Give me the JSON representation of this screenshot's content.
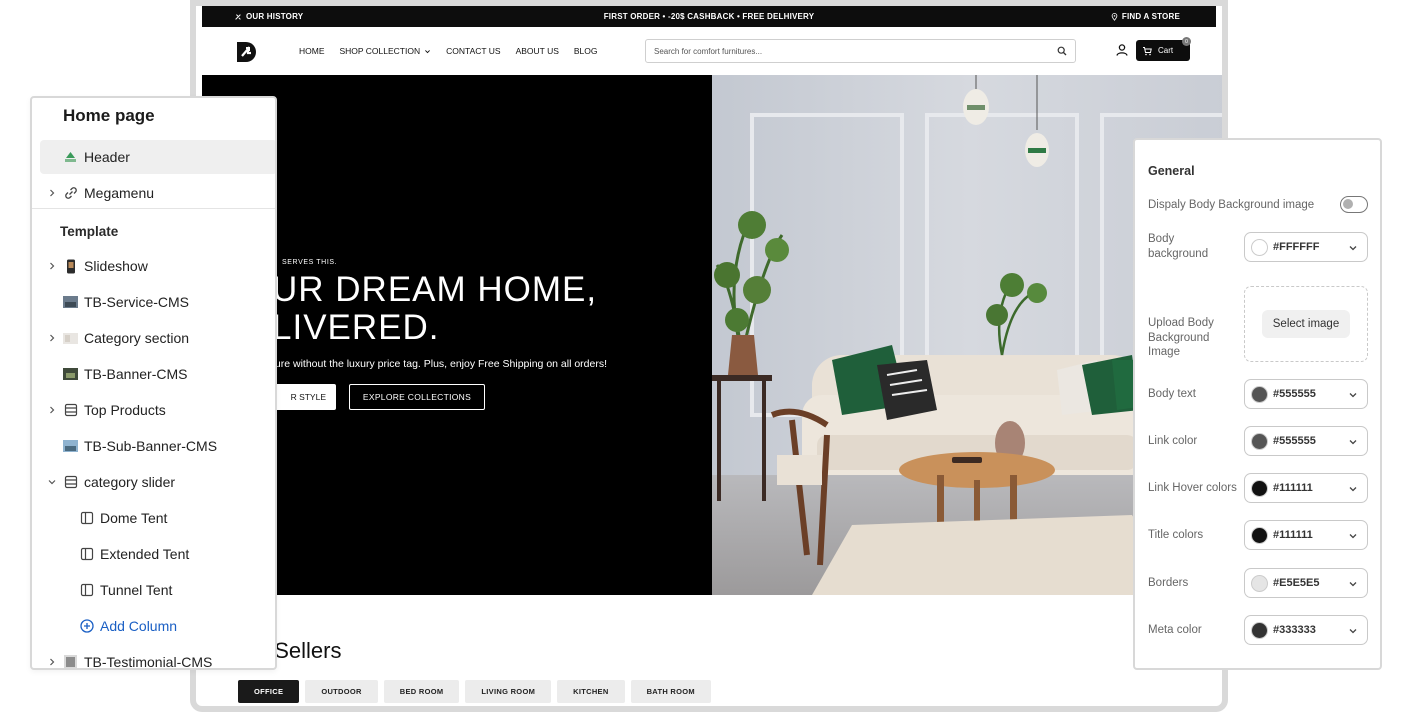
{
  "storefront": {
    "announcement": {
      "left": "OUR HISTORY",
      "center": "FIRST ORDER • -20$ CASHBACK • FREE DELHIVERY",
      "right": "FIND A STORE"
    },
    "nav": {
      "home": "HOME",
      "shop": "SHOP COLLECTION",
      "contact": "CONTACT US",
      "about": "ABOUT US",
      "blog": "BLOG"
    },
    "search_placeholder": "Search for comfort furnitures...",
    "cart_label": "Cart",
    "cart_count": "0",
    "hero": {
      "eyebrow": "SERVES THIS.",
      "title_line1": "UR DREAM HOME,",
      "title_line2": "LIVERED.",
      "subtitle": "ture without the luxury price tag. Plus, enjoy Free Shipping on all orders!",
      "primary_button": "R STYLE",
      "secondary_button": "EXPLORE COLLECTIONS"
    },
    "sellers_title": ": Sellers",
    "category_tabs": [
      "OFFICE",
      "OUTDOOR",
      "BED ROOM",
      "LIVING ROOM",
      "KITCHEN",
      "BATH ROOM"
    ],
    "active_tab": "OFFICE"
  },
  "sections_panel": {
    "title": "Home page",
    "header": "Header",
    "megamenu": "Megamenu",
    "template_label": "Template",
    "items": {
      "slideshow": "Slideshow",
      "service": "TB-Service-CMS",
      "category": "Category section",
      "banner": "TB-Banner-CMS",
      "top_products": "Top Products",
      "sub_banner": "TB-Sub-Banner-CMS",
      "category_slider": "category slider",
      "dome": "Dome Tent",
      "extended": "Extended Tent",
      "tunnel": "Tunnel Tent",
      "add_column": "Add Column",
      "testimonial": "TB-Testimonial-CMS"
    }
  },
  "settings_panel": {
    "heading": "General",
    "body_bg_image_label": "Dispaly Body Background image",
    "body_bg_image_enabled": false,
    "body_background": {
      "label_1": "Body",
      "label_2": "background",
      "value": "#FFFFFF"
    },
    "upload": {
      "label_1": "Upload Body",
      "label_2": "Background",
      "label_3": "Image",
      "button": "Select image"
    },
    "body_text": {
      "label": "Body text",
      "value": "#555555"
    },
    "link_color": {
      "label": "Link color",
      "value": "#555555"
    },
    "link_hover": {
      "label": "Link Hover colors",
      "value": "#111111"
    },
    "title_colors": {
      "label": "Title colors",
      "value": "#111111"
    },
    "borders": {
      "label": "Borders",
      "value": "#E5E5E5"
    },
    "meta_color": {
      "label": "Meta color",
      "value": "#333333"
    }
  }
}
